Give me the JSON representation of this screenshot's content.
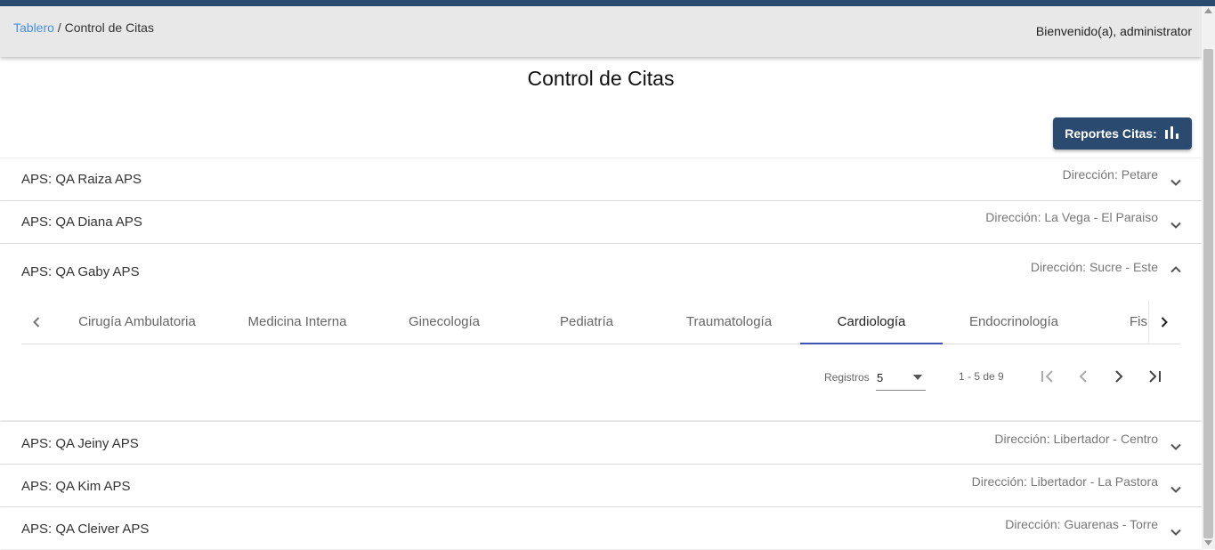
{
  "breadcrumb": {
    "link": "Tablero",
    "separator": " / ",
    "current": "Control de Citas"
  },
  "header": {
    "welcome": "Bienvenido(a), administrator"
  },
  "page": {
    "title": "Control de Citas"
  },
  "reports_button": {
    "label": "Reportes Citas:",
    "icon": "bar-chart-icon"
  },
  "panels": [
    {
      "title": "APS: QA Raiza APS",
      "direction": "Dirección: Petare",
      "expanded": false
    },
    {
      "title": "APS: QA Diana APS",
      "direction": "Dirección: La Vega - El Paraiso",
      "expanded": false
    },
    {
      "title": "APS: QA Gaby APS",
      "direction": "Dirección: Sucre - Este",
      "expanded": true
    },
    {
      "title": "APS: QA Jeiny APS",
      "direction": "Dirección: Libertador - Centro",
      "expanded": false
    },
    {
      "title": "APS: QA Kim APS",
      "direction": "Dirección: Libertador - La Pastora",
      "expanded": false
    },
    {
      "title": "APS: QA Cleiver APS",
      "direction": "Dirección: Guarenas - Torre",
      "expanded": false
    }
  ],
  "tabs": [
    {
      "label": "Cirugía Ambulatoria"
    },
    {
      "label": "Medicina Interna"
    },
    {
      "label": "Ginecología"
    },
    {
      "label": "Pediatría"
    },
    {
      "label": "Traumatología"
    },
    {
      "label": "Cardiología",
      "active": true
    },
    {
      "label": "Endocrinología"
    },
    {
      "label": "Fis"
    }
  ],
  "pager": {
    "label": "Registros",
    "page_size": "5",
    "range": "1 - 5 de 9"
  },
  "colors": {
    "primary": "#2b4a6f",
    "link": "#4a90e2",
    "tab_ink": "#3f51b5"
  }
}
